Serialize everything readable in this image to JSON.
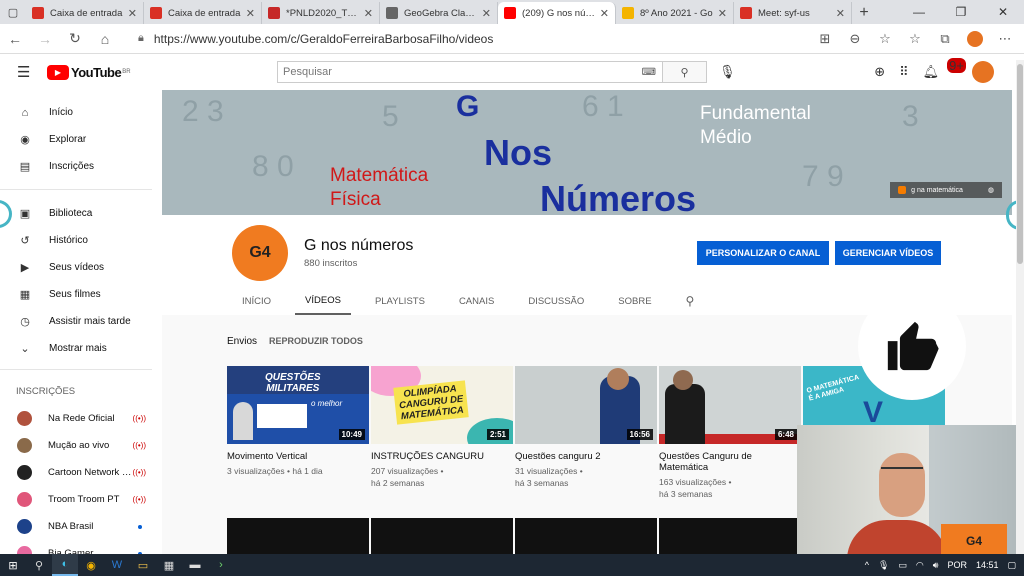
{
  "browser": {
    "tabs": [
      {
        "title": "Caixa de entrada",
        "favicon_color": "#d93025"
      },
      {
        "title": "Caixa de entrada",
        "favicon_color": "#d93025"
      },
      {
        "title": "*PNLD2020_TELA",
        "favicon_color": "#c62828"
      },
      {
        "title": "GeoGebra Classic",
        "favicon_color": "#666666"
      },
      {
        "title": "(209) G nos núme",
        "favicon_color": "#ff0000"
      },
      {
        "title": "8º Ano 2021 - Go",
        "favicon_color": "#f4b400"
      },
      {
        "title": "Meet: syf-us",
        "favicon_color": "#d93025"
      }
    ],
    "url": "https://www.youtube.com/c/GeraldoFerreiraBarbosaFilho/videos"
  },
  "youtube": {
    "logo_text": "YouTube",
    "logo_region": "BR",
    "search_placeholder": "Pesquisar",
    "notification_count": "9+"
  },
  "sidebar": {
    "items": [
      {
        "label": "Início",
        "icon": "home-icon",
        "glyph": "⌂"
      },
      {
        "label": "Explorar",
        "icon": "compass-icon",
        "glyph": "◉"
      },
      {
        "label": "Inscrições",
        "icon": "subscriptions-icon",
        "glyph": "▤"
      }
    ],
    "items2": [
      {
        "label": "Biblioteca",
        "icon": "library-icon",
        "glyph": "▣"
      },
      {
        "label": "Histórico",
        "icon": "history-icon",
        "glyph": "↺"
      },
      {
        "label": "Seus vídeos",
        "icon": "play-icon",
        "glyph": "▶"
      },
      {
        "label": "Seus filmes",
        "icon": "film-icon",
        "glyph": "▦"
      },
      {
        "label": "Assistir mais tarde",
        "icon": "clock-icon",
        "glyph": "◷"
      },
      {
        "label": "Mostrar mais",
        "icon": "chevron-down-icon",
        "glyph": "⌄"
      }
    ],
    "subs_heading": "INSCRIÇÕES",
    "subs": [
      {
        "label": "Na Rede Oficial",
        "live": true,
        "color": "#b0523d"
      },
      {
        "label": "Mução ao vivo",
        "live": true,
        "color": "#8a6a4a"
      },
      {
        "label": "Cartoon Network B...",
        "live": true,
        "color": "#222222"
      },
      {
        "label": "Troom Troom PT",
        "live": true,
        "color": "#e0567a"
      },
      {
        "label": "NBA Brasil",
        "live": false,
        "color": "#1d428a"
      },
      {
        "label": "Bia Gamer",
        "live": false,
        "color": "#e86aa0"
      }
    ]
  },
  "banner": {
    "g": "G",
    "nos": "Nos",
    "numeros": "Números",
    "materia_1": "Matemática",
    "materia_2": "Física",
    "nivel_1": "Fundamental",
    "nivel_2": "Médio",
    "link": "g na matemática"
  },
  "channel": {
    "avatar_text": "G4",
    "name": "G nos números",
    "subscribers": "880 inscritos",
    "customize_button": "PERSONALIZAR O CANAL",
    "manage_button": "GERENCIAR VÍDEOS",
    "tabs": [
      "INÍCIO",
      "VÍDEOS",
      "PLAYLISTS",
      "CANAIS",
      "DISCUSSÃO",
      "SOBRE"
    ],
    "active_tab": "VÍDEOS"
  },
  "uploads": {
    "heading": "Envios",
    "play_all": "REPRODUZIR TODOS",
    "videos": [
      {
        "title": "Movimento Vertical",
        "meta1": "3 visualizações • há 1 dia",
        "meta2": "",
        "duration": "10:49",
        "thumb_text_1": "QUESTÕES",
        "thumb_text_2": "MILITARES",
        "thumb_text_3": "o melhor"
      },
      {
        "title": "INSTRUÇÕES CANGURU",
        "meta1": "207 visualizações •",
        "meta2": "há 2 semanas",
        "duration": "2:51",
        "thumb_text_1": "OLIMPÍADA",
        "thumb_text_2": "CANGURU DE",
        "thumb_text_3": "MATEMÁTICA"
      },
      {
        "title": "Questões canguru 2",
        "meta1": "31 visualizações •",
        "meta2": "há 3 semanas",
        "duration": "16:56"
      },
      {
        "title": "Questões Canguru de Matemática",
        "meta1": "163 visualizações •",
        "meta2": "há 3 semanas",
        "duration": "6:48"
      }
    ],
    "partial_thumb_text": "O MATEMÁTICA É A AMIGA"
  },
  "taskbar": {
    "lang": "POR",
    "time": "14:51"
  }
}
